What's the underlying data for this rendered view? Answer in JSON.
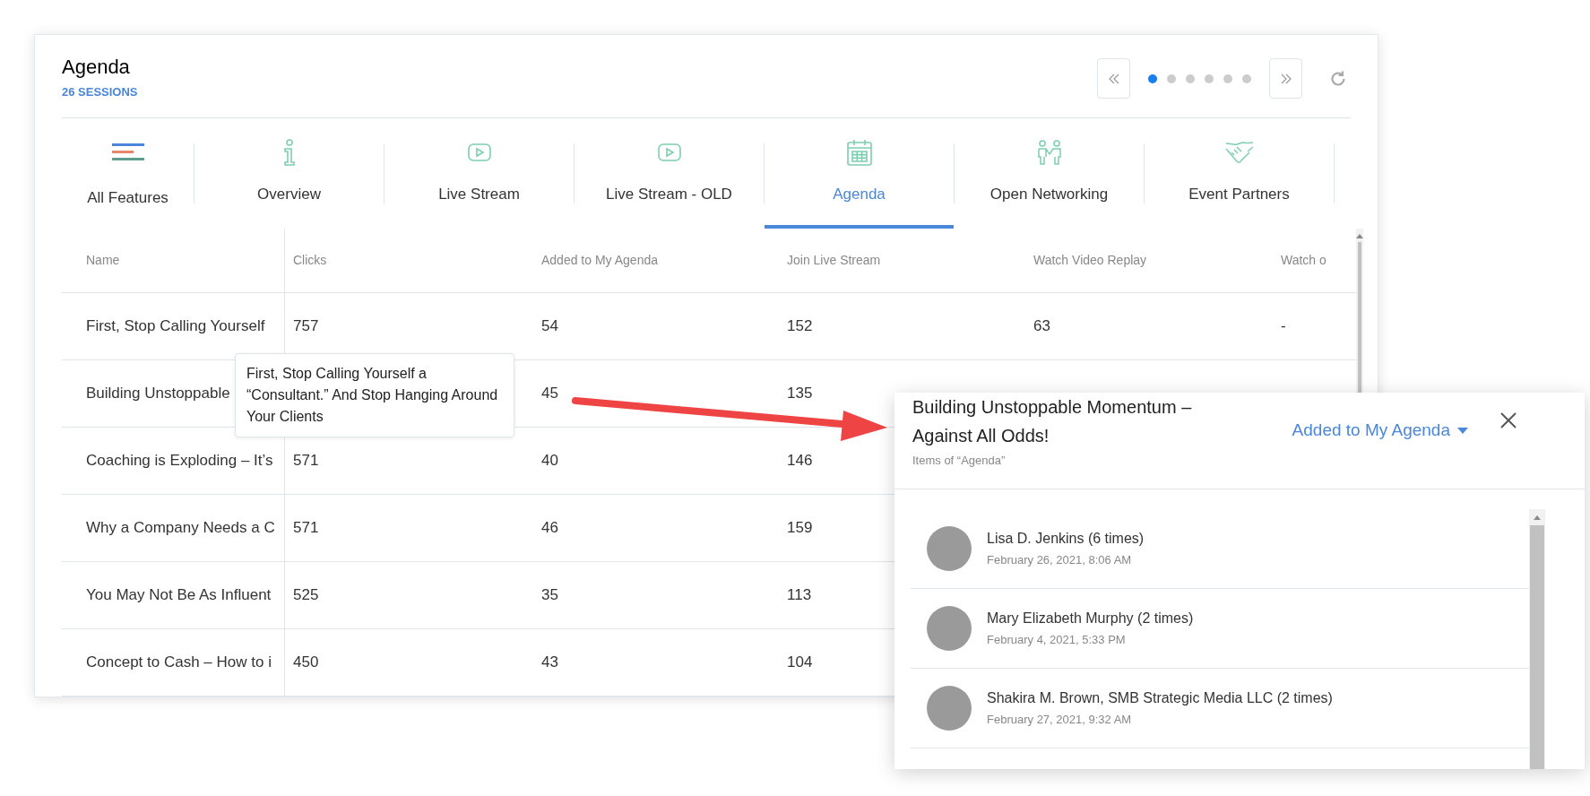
{
  "header": {
    "title": "Agenda",
    "subtitle": "26 SESSIONS"
  },
  "pager": {
    "dots": [
      {
        "selected": true
      },
      {
        "selected": false
      },
      {
        "selected": false
      },
      {
        "selected": false
      },
      {
        "selected": false
      },
      {
        "selected": false
      }
    ]
  },
  "tabs": [
    {
      "label": "All Features",
      "kind": "lines",
      "selected": false
    },
    {
      "label": "Overview",
      "kind": "info",
      "selected": false
    },
    {
      "label": "Live Stream",
      "kind": "play",
      "selected": false
    },
    {
      "label": "Live Stream - OLD",
      "kind": "play",
      "selected": false
    },
    {
      "label": "Agenda",
      "kind": "calendar",
      "selected": true
    },
    {
      "label": "Open Networking",
      "kind": "people",
      "selected": false
    },
    {
      "label": "Event Partners",
      "kind": "handshake",
      "selected": false
    }
  ],
  "table": {
    "columns": [
      "Name",
      "Clicks",
      "Added to My Agenda",
      "Join Live Stream",
      "Watch Video Replay",
      "Watch o"
    ],
    "rows": [
      {
        "cells": [
          "First, Stop Calling Yourself",
          "757",
          "54",
          "152",
          "63",
          "-"
        ]
      },
      {
        "cells": [
          "Building Unstoppable",
          "",
          "45",
          "135"
        ]
      },
      {
        "cells": [
          "Coaching is Exploding – It’s",
          "571",
          "40",
          "146"
        ]
      },
      {
        "cells": [
          "Why a Company Needs a C",
          "571",
          "46",
          "159"
        ]
      },
      {
        "cells": [
          "You May Not Be As Influent",
          "525",
          "35",
          "113"
        ]
      },
      {
        "cells": [
          "Concept to Cash – How to i",
          "450",
          "43",
          "104"
        ]
      }
    ]
  },
  "tooltip": {
    "text": "First, Stop Calling Yourself a “Consultant.” And Stop Hanging Around Your Clients"
  },
  "panel": {
    "title": "Building Unstoppable Momentum – Against All Odds!",
    "subtitle": "Items of “Agenda”",
    "filter": "Added to My Agenda",
    "people": [
      {
        "name": "Lisa D. Jenkins (6 times)",
        "date": "February 26, 2021, 8:06 AM"
      },
      {
        "name": "Mary Elizabeth Murphy (2 times)",
        "date": "February 4, 2021, 5:33 PM"
      },
      {
        "name": "Shakira M. Brown, SMB Strategic Media LLC (2 times)",
        "date": "February 27, 2021, 9:32 AM"
      }
    ]
  }
}
